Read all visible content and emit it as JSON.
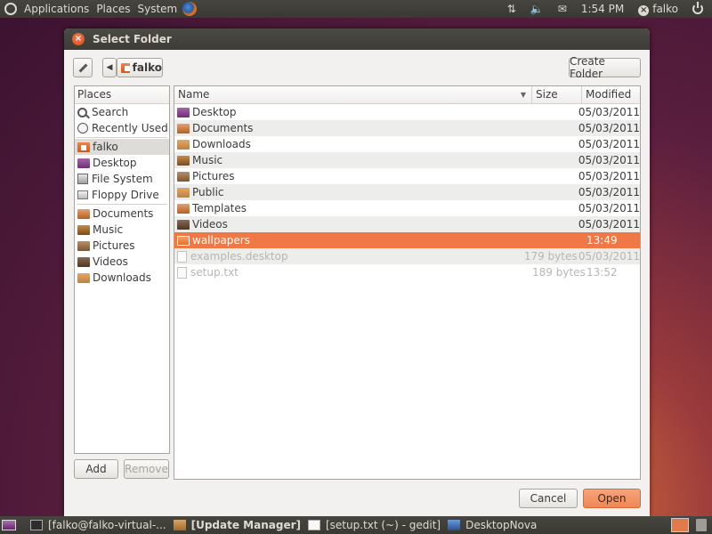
{
  "top_panel": {
    "menus": [
      "Applications",
      "Places",
      "System"
    ],
    "clock": "1:54 PM",
    "user": "falko"
  },
  "dialog": {
    "title": "Select Folder",
    "path_button": "falko",
    "create_folder": "Create Folder",
    "add": "Add",
    "remove": "Remove",
    "cancel": "Cancel",
    "open": "Open"
  },
  "places": {
    "header": "Places",
    "items": [
      {
        "label": "Search",
        "icon": "search-icon"
      },
      {
        "label": "Recently Used",
        "icon": "clock-icon"
      },
      {
        "label": "falko",
        "icon": "home-folder-icon"
      },
      {
        "label": "Desktop",
        "icon": "desktop-folder-icon"
      },
      {
        "label": "File System",
        "icon": "filesystem-icon"
      },
      {
        "label": "Floppy Drive",
        "icon": "floppy-icon"
      },
      {
        "label": "Documents",
        "icon": "documents-folder-icon"
      },
      {
        "label": "Music",
        "icon": "music-folder-icon"
      },
      {
        "label": "Pictures",
        "icon": "pictures-folder-icon"
      },
      {
        "label": "Videos",
        "icon": "videos-folder-icon"
      },
      {
        "label": "Downloads",
        "icon": "downloads-folder-icon"
      }
    ]
  },
  "files": {
    "columns": [
      "Name",
      "Size",
      "Modified"
    ],
    "rows": [
      {
        "name": "Desktop",
        "size": "",
        "modified": "05/03/2011"
      },
      {
        "name": "Documents",
        "size": "",
        "modified": "05/03/2011"
      },
      {
        "name": "Downloads",
        "size": "",
        "modified": "05/03/2011"
      },
      {
        "name": "Music",
        "size": "",
        "modified": "05/03/2011"
      },
      {
        "name": "Pictures",
        "size": "",
        "modified": "05/03/2011"
      },
      {
        "name": "Public",
        "size": "",
        "modified": "05/03/2011"
      },
      {
        "name": "Templates",
        "size": "",
        "modified": "05/03/2011"
      },
      {
        "name": "Videos",
        "size": "",
        "modified": "05/03/2011"
      },
      {
        "name": "wallpapers",
        "size": "",
        "modified": "13:49"
      },
      {
        "name": "examples.desktop",
        "size": "179 bytes",
        "modified": "05/03/2011"
      },
      {
        "name": "setup.txt",
        "size": "189 bytes",
        "modified": "13:52"
      }
    ]
  },
  "taskbar": {
    "tasks": [
      "[falko@falko-virtual-...",
      "[Update Manager]",
      "[setup.txt (~) - gedit]",
      "DesktopNova"
    ]
  },
  "colors": {
    "accent": "#f07746",
    "panel": "#3c3b37"
  }
}
